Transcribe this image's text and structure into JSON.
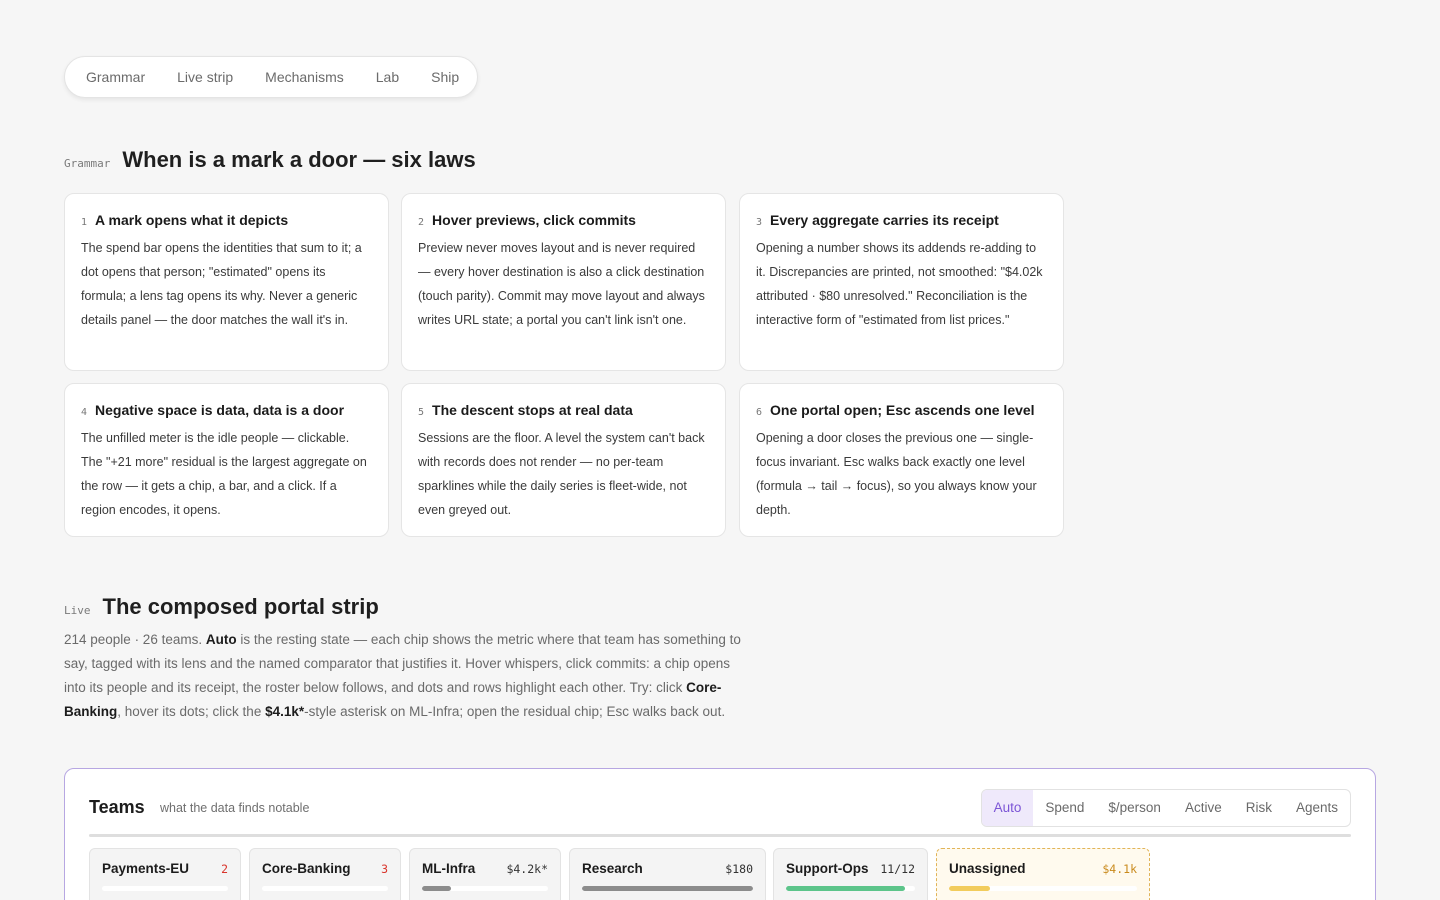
{
  "nav": {
    "items": [
      {
        "label": "Grammar"
      },
      {
        "label": "Live strip"
      },
      {
        "label": "Mechanisms"
      },
      {
        "label": "Lab"
      },
      {
        "label": "Ship"
      }
    ]
  },
  "grammar": {
    "eyebrow": "Grammar",
    "title": "When is a mark a door — six laws",
    "laws": [
      {
        "num": "1",
        "name": "A mark opens what it depicts",
        "body": "The spend bar opens the identities that sum to it; a dot opens that person; \"estimated\" opens its formula; a lens tag opens its why. Never a generic details panel — the door matches the wall it's in."
      },
      {
        "num": "2",
        "name": "Hover previews, click commits",
        "body": "Preview never moves layout and is never required — every hover destination is also a click destination (touch parity). Commit may move layout and always writes URL state; a portal you can't link isn't one."
      },
      {
        "num": "3",
        "name": "Every aggregate carries its receipt",
        "body": "Opening a number shows its addends re-adding to it. Discrepancies are printed, not smoothed: \"$4.02k attributed · $80 unresolved.\" Reconciliation is the interactive form of \"estimated from list prices.\""
      },
      {
        "num": "4",
        "name": "Negative space is data, data is a door",
        "body": "The unfilled meter is the idle people — clickable. The \"+21 more\" residual is the largest aggregate on the row — it gets a chip, a bar, and a click. If a region encodes, it opens."
      },
      {
        "num": "5",
        "name": "The descent stops at real data",
        "body": "Sessions are the floor. A level the system can't back with records does not render — no per-team sparklines while the daily series is fleet-wide, not even greyed out."
      },
      {
        "num": "6",
        "name": "One portal open; Esc ascends one level",
        "body": "Opening a door closes the previous one — single-focus invariant. Esc walks back exactly one level (formula → tail → focus), so you always know your depth."
      }
    ]
  },
  "live": {
    "eyebrow": "Live",
    "title": "The composed portal strip",
    "desc": {
      "p1": "214 people · 26 teams. ",
      "b1": "Auto",
      "p2": " is the resting state — each chip shows the metric where that team has something to say, tagged with its lens and the named comparator that justifies it. Hover whispers, click commits: a chip opens into its people and its receipt, the roster below follows, and dots and rows highlight each other. Try: click ",
      "b2": "Core-Banking",
      "p3": ", hover its dots; click the ",
      "b3": "$4.1k*",
      "p4": "-style asterisk on ML-Infra; open the residual chip; Esc walks back out."
    }
  },
  "panel": {
    "title": "Teams",
    "subtitle": "what the data finds notable",
    "lenses": [
      "Auto",
      "Spend",
      "$/person",
      "Active",
      "Risk",
      "Agents"
    ],
    "active_lens": "Auto",
    "accent": "#7c55d6"
  },
  "chips": [
    {
      "name": "Payments-EU",
      "value": "2",
      "fill": 0.0,
      "color": "#d9342b",
      "fill_color": "#9a9a9a"
    },
    {
      "name": "Core-Banking",
      "value": "3",
      "fill": 0.0,
      "color": "#d9342b",
      "fill_color": "#9a9a9a"
    },
    {
      "name": "ML-Infra",
      "value": "$4.2k*",
      "fill": 0.23,
      "color": "#333333",
      "fill_color": "#8c8c8c"
    },
    {
      "name": "Research",
      "value": "$180",
      "fill": 1.0,
      "color": "#333333",
      "fill_color": "#8c8c8c"
    },
    {
      "name": "Support-Ops",
      "value": "11/12",
      "fill": 0.92,
      "color": "#333333",
      "fill_color": "#5cc48a"
    },
    {
      "name": "Unassigned",
      "value": "$4.1k",
      "fill": 0.22,
      "color": "#c98a1c",
      "fill_color": "#f2cc5c"
    }
  ]
}
